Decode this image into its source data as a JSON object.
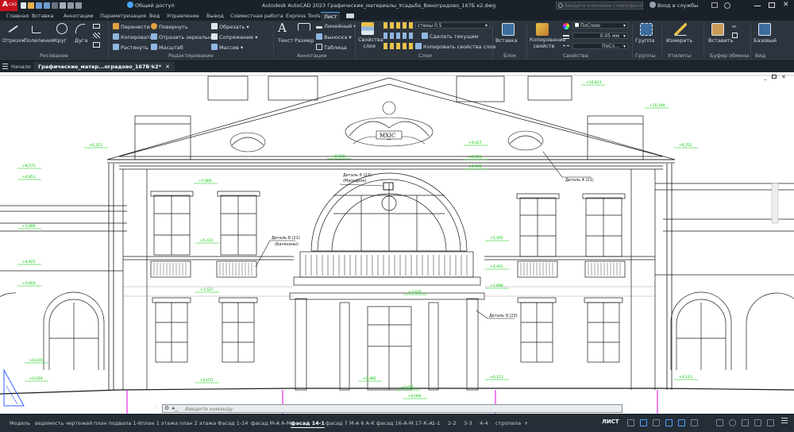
{
  "app": {
    "logo_text": "A",
    "logo_sub": "CAD",
    "quick_access": "Общий доступ",
    "title": "Autodesk AutoCAD 2023   Графические_материалы_Усадьба_Виноградово_167Б к2.dwg",
    "search_placeholder": "Введите ключевое слово/фразу",
    "signin": "Вход в службы"
  },
  "ribbon_tabs": [
    "Главная",
    "Вставка",
    "Аннотации",
    "Параметризация",
    "Вид",
    "Управление",
    "Вывод",
    "Совместная работа",
    "Express Tools",
    "Лист"
  ],
  "active_ribbon_tab": 9,
  "draw_panel": {
    "title": "Рисование",
    "tools": [
      "Отрезок",
      "Полилиния",
      "Круг",
      "Дуга"
    ]
  },
  "modify_panel": {
    "title": "Редактирование",
    "col1": [
      "Перенести",
      "Копировать",
      "Растянуть"
    ],
    "col2": [
      "Повернуть",
      "Отразить зеркально",
      "Масштаб"
    ],
    "col3": [
      "Обрезать",
      "Сопряжение",
      "Массив"
    ]
  },
  "annotation_panel": {
    "title": "Аннотации",
    "big": [
      "Текст",
      "Размер"
    ],
    "small": [
      "Линейный",
      "Выноска",
      "Таблица"
    ]
  },
  "layers_panel": {
    "title": "Слои",
    "big": "Свойства слоя",
    "current_layer": "стены 0.5",
    "small": [
      "Сделать текущим",
      "Копировать свойства слоя"
    ]
  },
  "block_panel": {
    "title": "Блок",
    "big": "Вставка"
  },
  "properties_panel": {
    "title": "Свойства",
    "big": "Копирование свойств",
    "color": "ПоСлою",
    "lineweight": "0.05 мм",
    "linetype": "ПоСл..."
  },
  "groups_panel": {
    "title": "Группы",
    "big": "Группа"
  },
  "utilities_panel": {
    "title": "Утилиты",
    "big": "Измерить"
  },
  "clipboard_panel": {
    "title": "Буфер обмена",
    "big": "Вставить"
  },
  "view_panel": {
    "title": "Вид",
    "big": "Базовый"
  },
  "file_tabs": [
    "Начало",
    "Графические_матер...оградово_167Б к2*"
  ],
  "active_file_tab": 1,
  "command_placeholder": "Введите команду",
  "layout_tabs": [
    "Модель",
    "ведомость чертежей",
    "план подвала 1-6",
    "план 1 этажа",
    "план 2 этажа",
    "Фасад 1-14",
    "фасад М-А А-М",
    "фасад 14-1",
    "фасад 7 М-А 6 А-К",
    "фасад 16-А-М 17-К-А",
    "1-1",
    "2-2",
    "3-3",
    "4-4",
    "стропила",
    "+"
  ],
  "active_layout_tab": 7,
  "status": {
    "mode": "ЛИСТ"
  },
  "drawing_labels": {
    "detail6": "Деталь 6 (22)",
    "detail6_sub": "(Маскарон)",
    "detail4": "Деталь 4 (21)",
    "detail8": "Деталь 8 (21)",
    "detail8_sub": "(Балясины)",
    "detail9": "Деталь 9 (23)",
    "pediment_text": "MXIC"
  },
  "level_marks": [
    "+10,823",
    "+8,918",
    "+10,194",
    "+6,321",
    "+9,427",
    "+8,855",
    "+6,253",
    "+8,573",
    "+4,651",
    "+7,800",
    "+5,431",
    "+4,990",
    "+3,899",
    "+4,825",
    "+5,565",
    "+4,401",
    "+3,688",
    "+3,660",
    "+3,626",
    "+3,527",
    "+0,430",
    "+0,029",
    "+0,085",
    "+0,071",
    "+0,111",
    "+0,094",
    "+0,113",
    "+0,095"
  ],
  "colors": {
    "accent": "#4aa3ff",
    "level_green": "#00c800",
    "magenta": "#e000e0",
    "ribbon": "#2c343e"
  }
}
